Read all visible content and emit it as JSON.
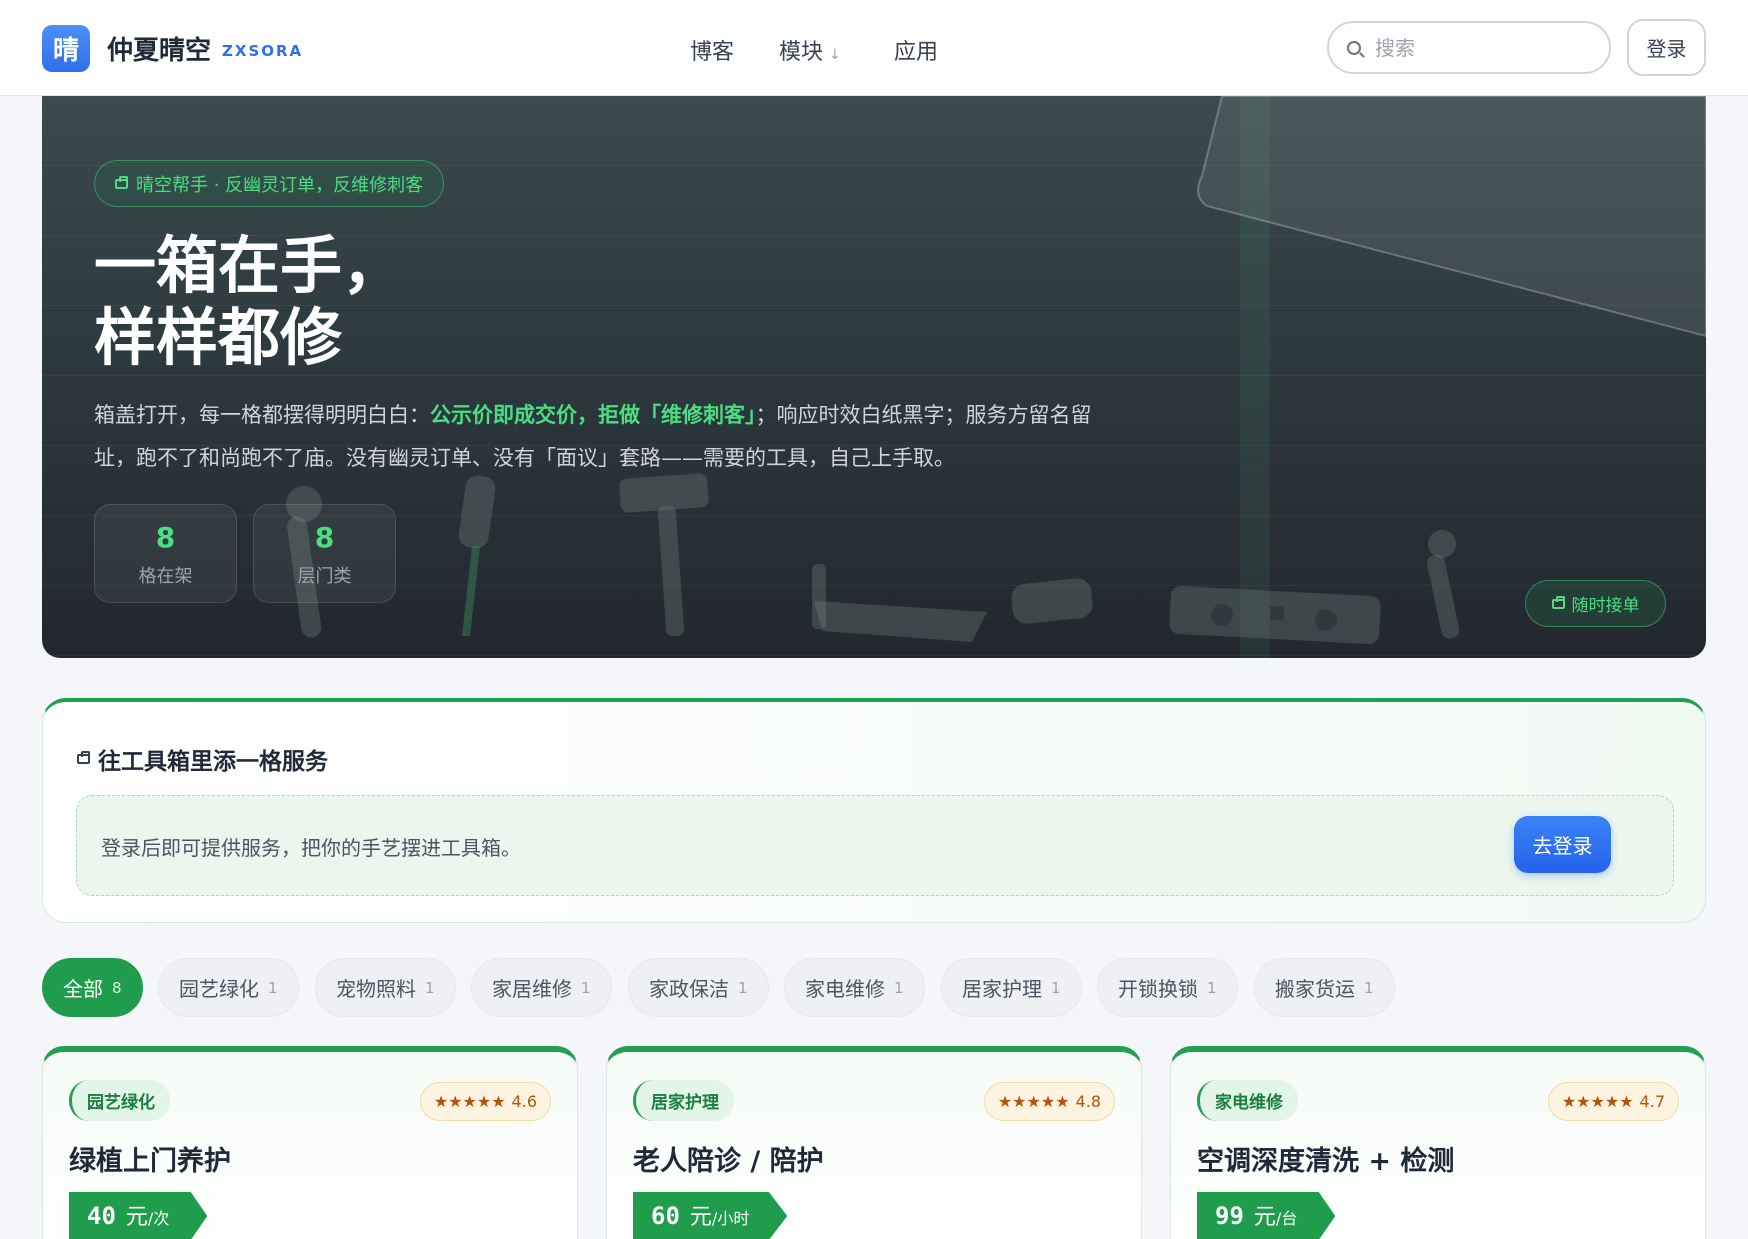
{
  "header": {
    "logo_char": "晴",
    "brand_name": "仲夏晴空",
    "brand_sub": "ZXSORA",
    "nav": [
      {
        "label": "博客"
      },
      {
        "label": "模块",
        "arrow": "↓"
      },
      {
        "label": "应用"
      }
    ],
    "search_placeholder": "搜索",
    "login_label": "登录"
  },
  "hero": {
    "tag": "晴空帮手 · 反幽灵订单，反维修刺客",
    "title_line1": "一箱在手，",
    "title_line2": "样样都修",
    "desc_part1": "箱盖打开，每一格都摆得明明白白：",
    "desc_highlight": "公示价即成交价，拒做「维修刺客」",
    "desc_part2": "；响应时效白纸黑字；服务方留名留址，跑不了和尚跑不了庙。没有幽灵订单、没有「面议」套路——需要的工具，自己上手取。",
    "stats": [
      {
        "num": "8",
        "label": "格在架"
      },
      {
        "num": "8",
        "label": "层门类"
      }
    ],
    "order_button": "随时接单"
  },
  "panel": {
    "title": "往工具箱里添一格服务",
    "text": "登录后即可提供服务，把你的手艺摆进工具箱。",
    "button": "去登录"
  },
  "filters": [
    {
      "label": "全部",
      "count": "8",
      "active": true
    },
    {
      "label": "园艺绿化",
      "count": "1"
    },
    {
      "label": "宠物照料",
      "count": "1"
    },
    {
      "label": "家居维修",
      "count": "1"
    },
    {
      "label": "家政保洁",
      "count": "1"
    },
    {
      "label": "家电维修",
      "count": "1"
    },
    {
      "label": "居家护理",
      "count": "1"
    },
    {
      "label": "开锁换锁",
      "count": "1"
    },
    {
      "label": "搬家货运",
      "count": "1"
    }
  ],
  "cards": [
    {
      "category": "园艺绿化",
      "stars": "★★★★★",
      "rating": "4.6",
      "title": "绿植上门养护",
      "price": "40",
      "unit": "元",
      "per": "/次"
    },
    {
      "category": "居家护理",
      "stars": "★★★★★",
      "rating": "4.8",
      "title": "老人陪诊 / 陪护",
      "price": "60",
      "unit": "元",
      "per": "/小时"
    },
    {
      "category": "家电维修",
      "stars": "★★★★★",
      "rating": "4.7",
      "title": "空调深度清洗 + 检测",
      "price": "99",
      "unit": "元",
      "per": "/台"
    }
  ],
  "colors": {
    "accent_green": "#1f9d4c",
    "accent_blue": "#2f6fe8",
    "highlight_green": "#4ade80"
  }
}
